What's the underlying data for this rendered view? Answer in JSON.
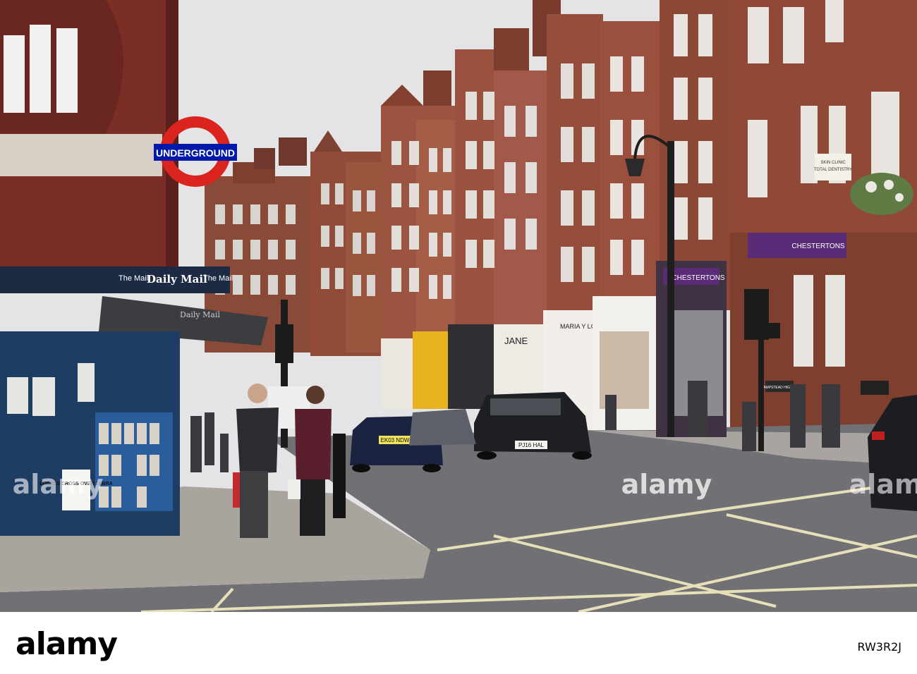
{
  "photo": {
    "underground_sign": "UNDERGROUND",
    "kiosk_header_left": "The Mail",
    "kiosk_header_center": "Daily Mail",
    "kiosk_header_right": "The Mail",
    "kiosk_awning": "Daily Mail",
    "kiosk_poster": "LOCALS CROSS OVER ZEBRA",
    "shop_jane": "JANE",
    "shop_maria": "MARIA Y LOLA",
    "shop_chestertons_1": "CHESTERTONS",
    "shop_chestertons_2": "CHESTERTONS",
    "shop_clinic_line1": "SKIN CLINIC",
    "shop_clinic_line2": "TOTAL DENTISTRY",
    "plate_bmw": "PJ16 HAL",
    "plate_jaguar": "EK03 NDW",
    "street_sign": "HAMPSTEAD HIGH ST",
    "watermark_center": "alamy",
    "watermark_left": "alamy",
    "watermark_right": "alamy"
  },
  "footer": {
    "logo": "alamy",
    "image_id": "RW3R2J"
  },
  "colors": {
    "sky": "#e6e6e8",
    "brick": "#8e4a36",
    "brick_dark": "#5e2d22",
    "road": "#6e6e73",
    "pavement": "#a7a29d",
    "tube_red": "#dc241f",
    "tube_blue": "#0019a8",
    "kiosk_blue": "#1d3a5f",
    "chestertons_purple": "#5a2c78"
  }
}
